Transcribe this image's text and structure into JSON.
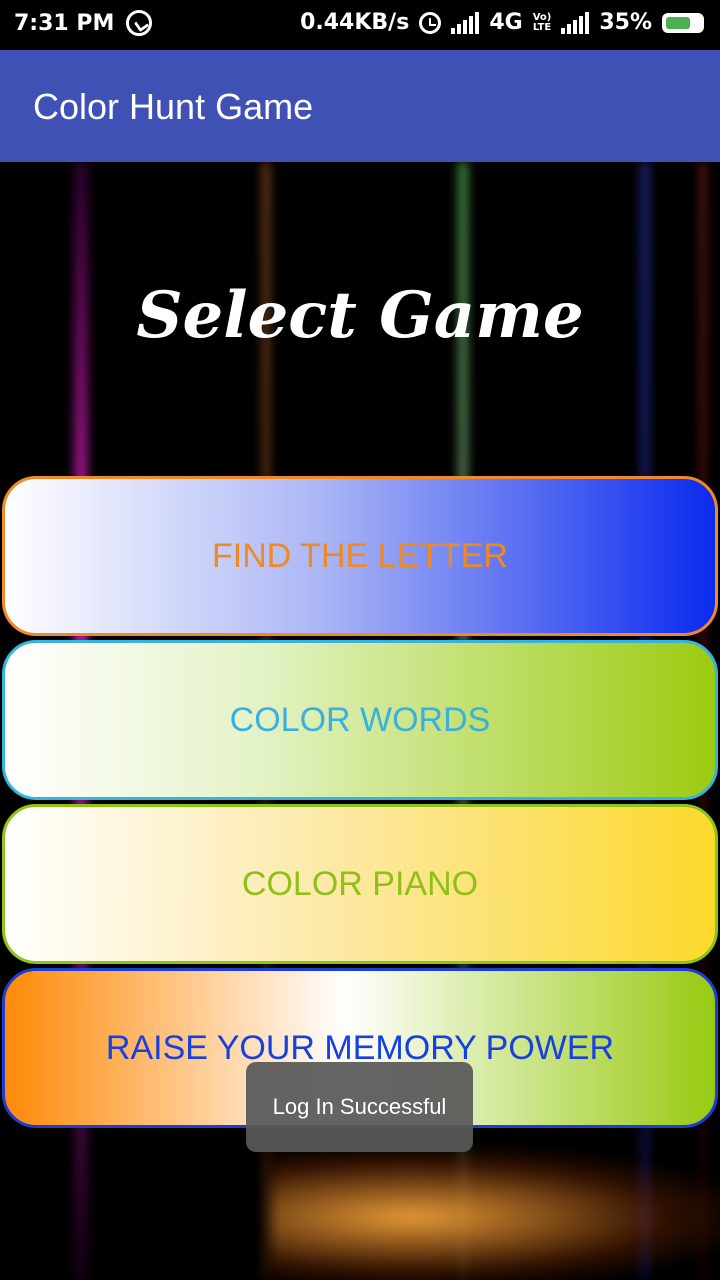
{
  "status_bar": {
    "time": "7:31 PM",
    "speed": "0.44KB/s",
    "network": "4G",
    "lte": "LTE",
    "battery": "35%",
    "icons": [
      "whatsapp-icon",
      "alarm-icon",
      "signal-icon",
      "lte-icon",
      "signal-icon",
      "battery-charging-icon"
    ]
  },
  "app_bar": {
    "title": "Color Hunt Game",
    "color": "#3f51b5"
  },
  "main": {
    "heading": "Select Game",
    "buttons": [
      {
        "label": "FIND THE LETTER",
        "text_color": "#f08a20"
      },
      {
        "label": "COLOR WORDS",
        "text_color": "#3ab0df"
      },
      {
        "label": "COLOR PIANO",
        "text_color": "#8fc01a"
      },
      {
        "label": "RAISE YOUR MEMORY POWER",
        "text_color": "#1740e0"
      }
    ]
  },
  "toast": {
    "message": "Log In Successful"
  }
}
